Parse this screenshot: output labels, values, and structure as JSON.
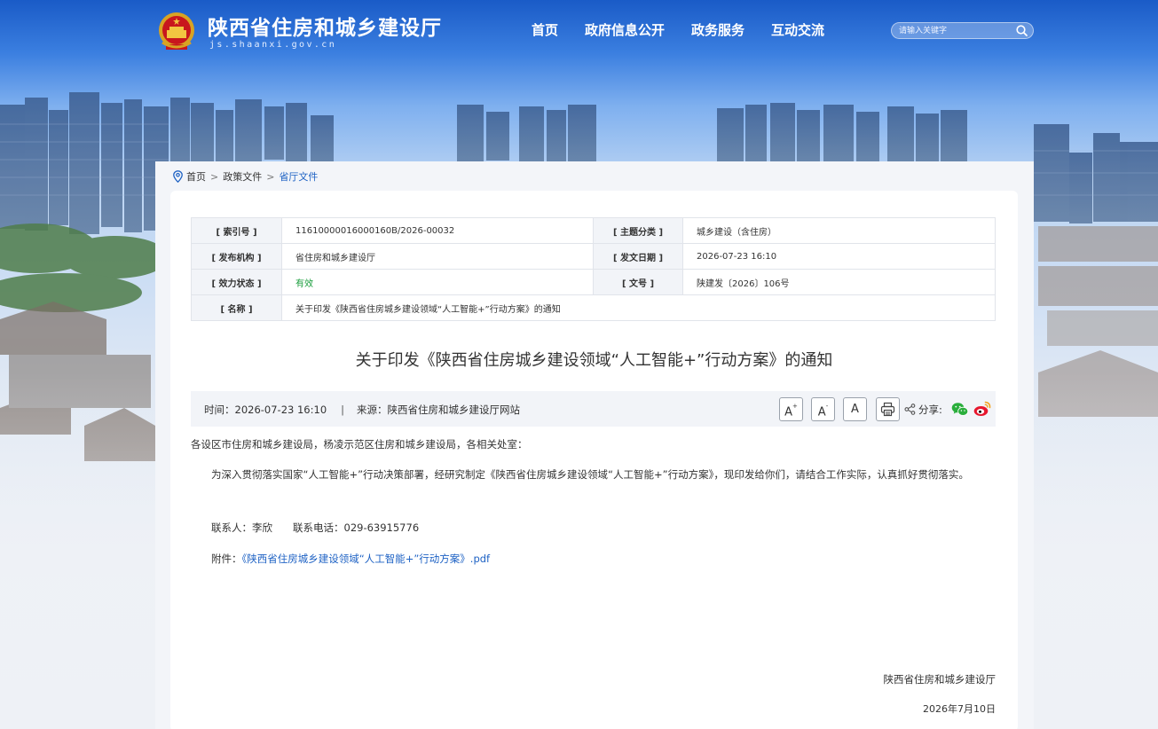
{
  "header": {
    "site_title": "陕西省住房和城乡建设厅",
    "site_domain": "js.shaanxi.gov.cn",
    "nav": [
      "首页",
      "政府信息公开",
      "政务服务",
      "互动交流"
    ],
    "search_placeholder": "请输入关键字"
  },
  "breadcrumb": {
    "items": [
      "首页",
      "政策文件",
      "省厅文件"
    ],
    "separator": ">"
  },
  "meta": {
    "index_label": "[ 索引号 ]",
    "index_value": "11610000016000160B/2026-00032",
    "topic_label": "[ 主题分类 ]",
    "topic_value": "城乡建设（含住房）",
    "publisher_label": "[ 发布机构 ]",
    "publisher_value": "省住房和城乡建设厅",
    "date_label": "[ 发文日期 ]",
    "date_value": "2026-07-23 16:10",
    "status_label": "[ 效力状态 ]",
    "status_value": "有效",
    "docno_label": "[ 文号 ]",
    "docno_value": "陕建发〔2026〕106号",
    "name_label": "[ 名称 ]",
    "name_value": "关于印发《陕西省住房城乡建设领域“人工智能+”行动方案》的通知"
  },
  "article": {
    "title": "关于印发《陕西省住房城乡建设领域“人工智能+”行动方案》的通知",
    "time_label": "时间：",
    "time_value": "2026-07-23 16:10",
    "divider": "|",
    "source_label": "来源：",
    "source_value": "陕西省住房和城乡建设厅网站",
    "font_large": "A",
    "font_large_sup": "+",
    "font_small": "A",
    "font_small_sup": "-",
    "font_reset": "A",
    "share_label": "分享:",
    "salutation": "各设区市住房和城乡建设局，杨凌示范区住房和城乡建设局，各相关处室：",
    "paragraph1": "为深入贯彻落实国家“人工智能+”行动决策部署，经研究制定《陕西省住房城乡建设领域“人工智能+”行动方案》，现印发给你们，请结合工作实际，认真抓好贯彻落实。",
    "contact": "联系人：李欣　　联系电话：029-63915776",
    "attachment_label": "附件：",
    "attachment_link": "《陕西省住房城乡建设领域“人工智能+”行动方案》.pdf",
    "signature": "陕西省住房和城乡建设厅",
    "sign_date": "2026年7月10日"
  },
  "colors": {
    "link": "#1e62c4",
    "status_green": "#179c3a",
    "sky_top": "#1a5bc7"
  }
}
